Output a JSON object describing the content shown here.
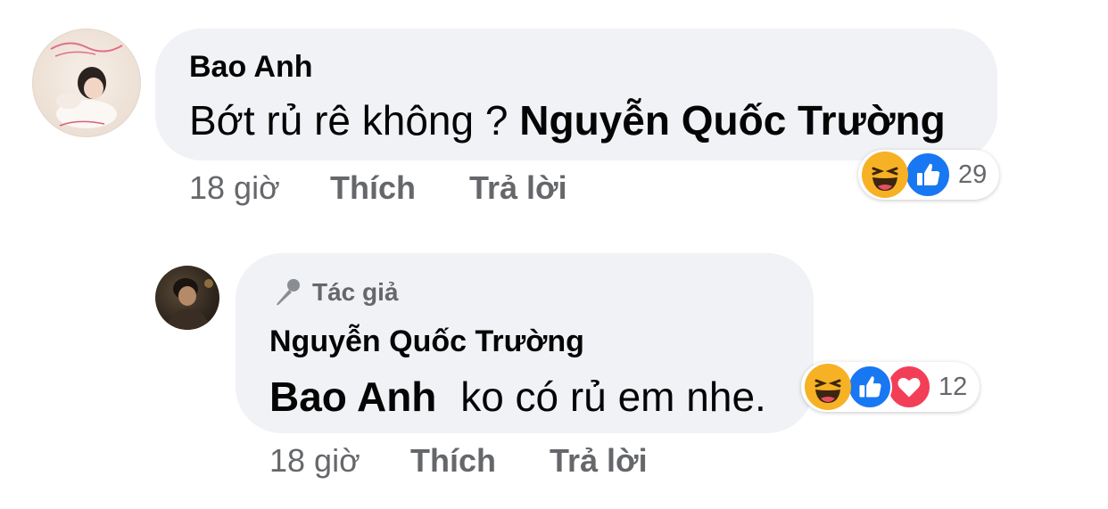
{
  "comment": {
    "author": "Bao Anh",
    "text": "Bớt rủ rê không ?",
    "mention": "Nguyễn Quốc Trường",
    "time": "18 giờ",
    "like_label": "Thích",
    "reply_label": "Trả lời",
    "reactions": {
      "icons": [
        "haha-icon",
        "like-icon"
      ],
      "count": "29"
    }
  },
  "reply": {
    "badge": "Tác giả",
    "author": "Nguyễn Quốc Trường",
    "mention": "Bao Anh",
    "text": "ko có rủ em nhe.",
    "time": "18 giờ",
    "like_label": "Thích",
    "reply_label": "Trả lời",
    "reactions": {
      "icons": [
        "haha-icon",
        "like-icon",
        "love-icon"
      ],
      "count": "12"
    }
  },
  "colors": {
    "bubble": "#f0f2f5",
    "meta_text": "#65676b",
    "like_blue": "#1877f2",
    "love_red": "#f33e58",
    "haha_yellow": "#f7b125"
  }
}
